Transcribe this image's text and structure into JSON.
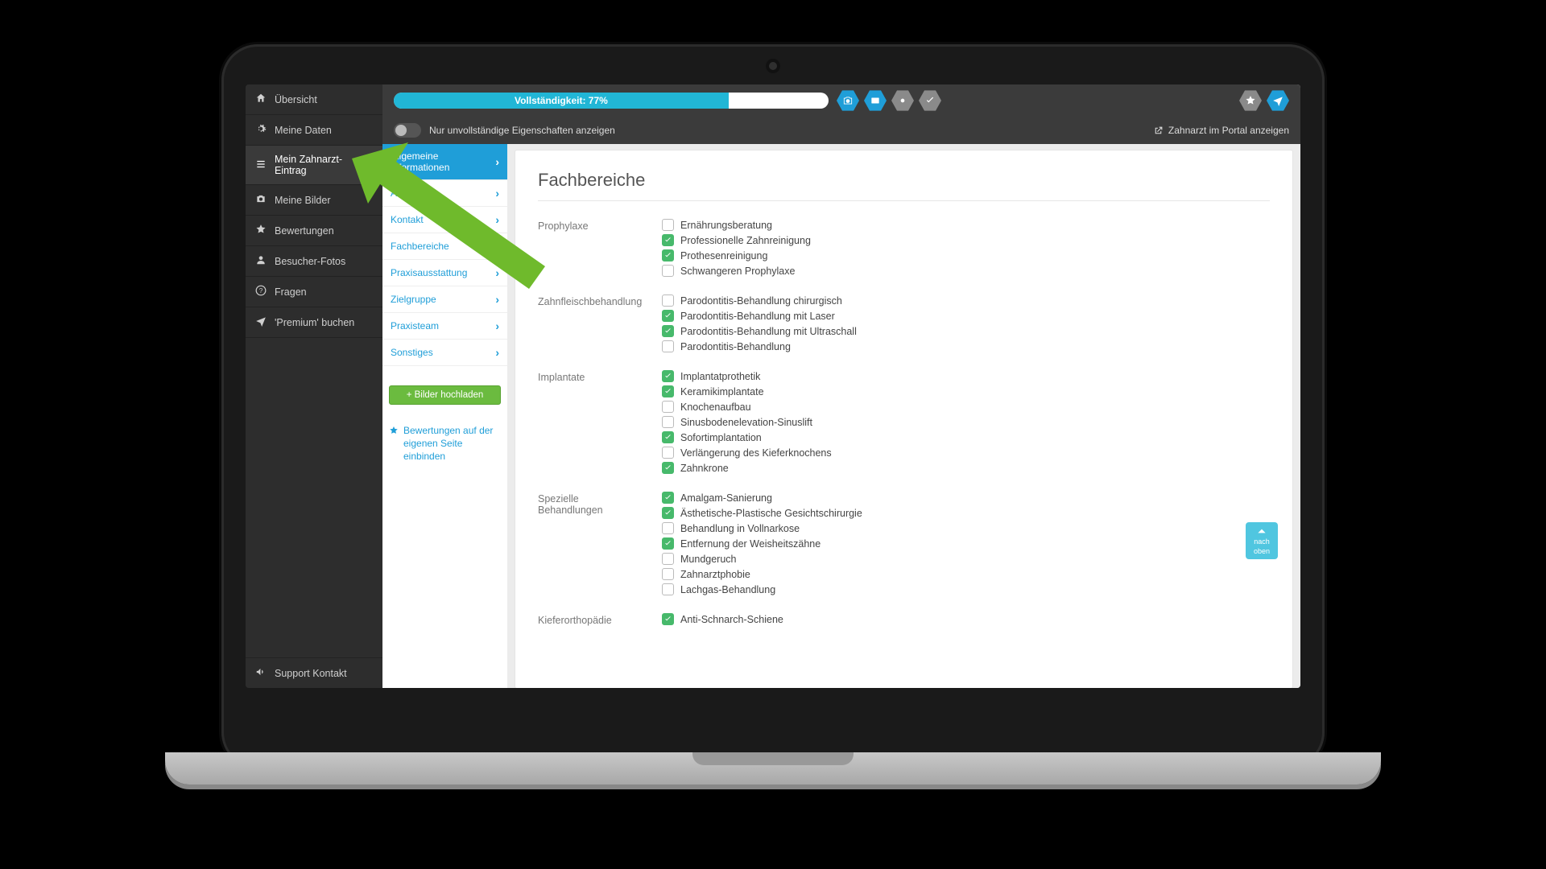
{
  "nav": {
    "items": [
      {
        "label": "Übersicht",
        "icon": "home"
      },
      {
        "label": "Meine Daten",
        "icon": "gear"
      },
      {
        "label": "Mein Zahnarzt-Eintrag",
        "icon": "list",
        "active": true
      },
      {
        "label": "Meine Bilder",
        "icon": "camera"
      },
      {
        "label": "Bewertungen",
        "icon": "star"
      },
      {
        "label": "Besucher-Fotos",
        "icon": "user"
      },
      {
        "label": "Fragen",
        "icon": "question"
      },
      {
        "label": "'Premium' buchen",
        "icon": "plane"
      }
    ],
    "footer": {
      "label": "Support Kontakt",
      "icon": "bullhorn"
    }
  },
  "topbar": {
    "progress_label": "Vollständigkeit: 77%",
    "progress_pct": 77,
    "toggle_label": "Nur unvollständige Eigenschaften anzeigen",
    "portal_link": "Zahnarzt im Portal anzeigen"
  },
  "subnav": {
    "items": [
      {
        "label": "Allgemeine Informationen",
        "active": true
      },
      {
        "label": "Adresse"
      },
      {
        "label": "Kontakt"
      },
      {
        "label": "Fachbereiche"
      },
      {
        "label": "Praxisausstattung"
      },
      {
        "label": "Zielgruppe"
      },
      {
        "label": "Praxisteam"
      },
      {
        "label": "Sonstiges"
      }
    ],
    "upload_btn": "+ Bilder hochladen",
    "embed_link": "Bewertungen auf der eigenen Seite einbinden"
  },
  "page": {
    "title": "Fachbereiche",
    "groups": [
      {
        "label": "Prophylaxe",
        "opts": [
          {
            "label": "Ernährungsberatung",
            "checked": false
          },
          {
            "label": "Professionelle Zahnreinigung",
            "checked": true
          },
          {
            "label": "Prothesenreinigung",
            "checked": true
          },
          {
            "label": "Schwangeren Prophylaxe",
            "checked": false
          }
        ]
      },
      {
        "label": "Zahnfleischbehandlung",
        "opts": [
          {
            "label": "Parodontitis-Behandlung chirurgisch",
            "checked": false
          },
          {
            "label": "Parodontitis-Behandlung mit Laser",
            "checked": true
          },
          {
            "label": "Parodontitis-Behandlung mit Ultraschall",
            "checked": true
          },
          {
            "label": "Parodontitis-Behandlung",
            "checked": false
          }
        ]
      },
      {
        "label": "Implantate",
        "opts": [
          {
            "label": "Implantatprothetik",
            "checked": true
          },
          {
            "label": "Keramikimplantate",
            "checked": true
          },
          {
            "label": "Knochenaufbau",
            "checked": false
          },
          {
            "label": "Sinusbodenelevation-Sinuslift",
            "checked": false
          },
          {
            "label": "Sofortimplantation",
            "checked": true
          },
          {
            "label": "Verlängerung des Kieferknochens",
            "checked": false
          },
          {
            "label": "Zahnkrone",
            "checked": true
          }
        ]
      },
      {
        "label": "Spezielle Behandlungen",
        "opts": [
          {
            "label": "Amalgam-Sanierung",
            "checked": true
          },
          {
            "label": "Ästhetische-Plastische Gesichtschirurgie",
            "checked": true
          },
          {
            "label": "Behandlung in Vollnarkose",
            "checked": false
          },
          {
            "label": "Entfernung der Weisheitszähne",
            "checked": true
          },
          {
            "label": "Mundgeruch",
            "checked": false
          },
          {
            "label": "Zahnarztphobie",
            "checked": false
          },
          {
            "label": "Lachgas-Behandlung",
            "checked": false
          }
        ]
      },
      {
        "label": "Kieferorthopädie",
        "opts": [
          {
            "label": "Anti-Schnarch-Schiene",
            "checked": true
          }
        ]
      }
    ]
  },
  "to_top": {
    "line1": "nach",
    "line2": "oben"
  },
  "colors": {
    "accent": "#21b6d6",
    "green": "#6bbb3f",
    "check": "#47b96b",
    "annotation_arrow": "#6fba2c"
  }
}
